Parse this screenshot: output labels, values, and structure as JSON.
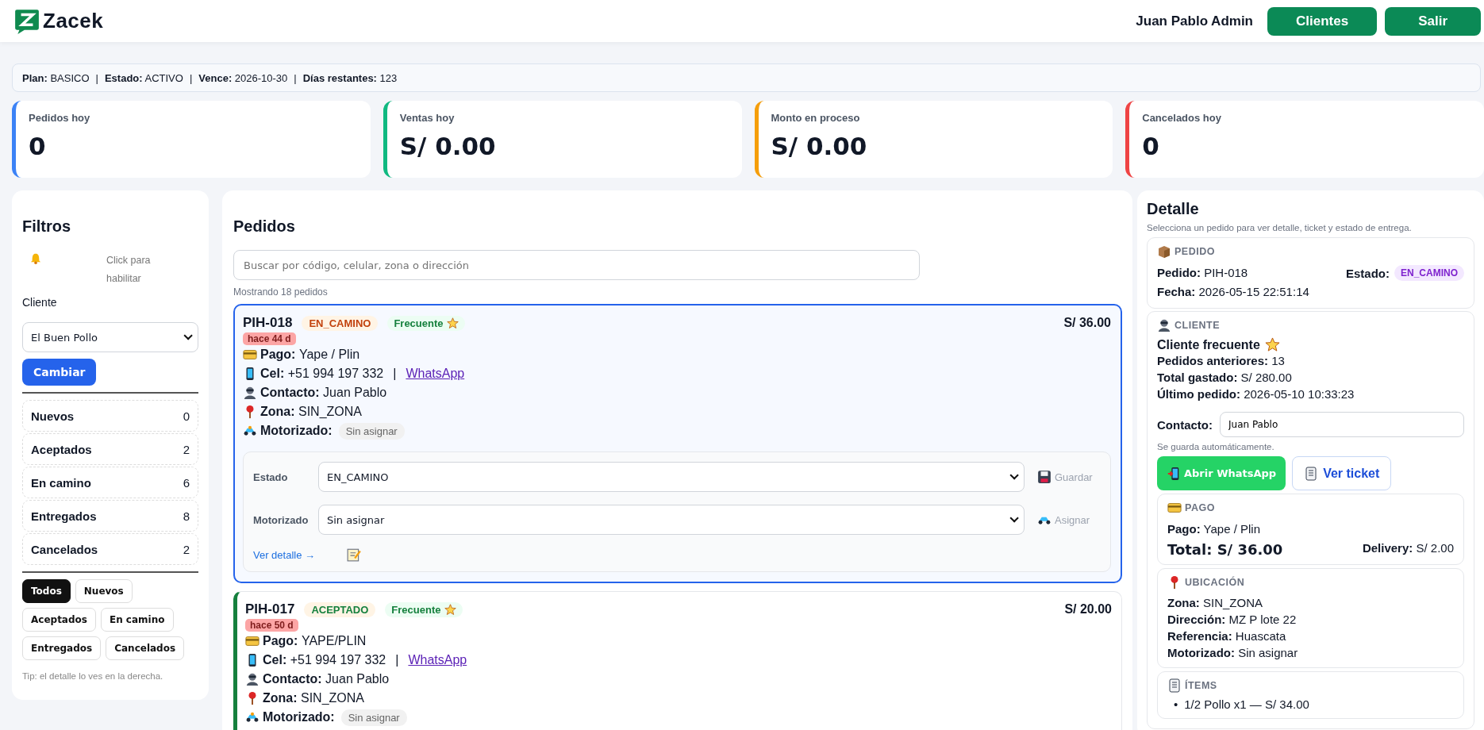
{
  "header": {
    "brand": "Zacek",
    "user": "Juan Pablo Admin",
    "buttons": [
      "Clientes",
      "Salir"
    ]
  },
  "plan_bar": [
    {
      "label": "Plan:",
      "value": "BASICO",
      "separator": "|"
    },
    {
      "label": "Estado:",
      "value": "ACTIVO",
      "separator": "|"
    },
    {
      "label": "Vence:",
      "value": "2026-10-30",
      "separator": "|"
    },
    {
      "label": "Días restantes:",
      "value": "123"
    }
  ],
  "stats": [
    {
      "label": "Pedidos hoy",
      "value": "0",
      "color": "#3b82f6"
    },
    {
      "label": "Ventas hoy",
      "value": "S/ 0.00",
      "color": "#10b981"
    },
    {
      "label": "Monto en proceso",
      "value": "S/ 0.00",
      "color": "#f59e0b"
    },
    {
      "label": "Cancelados hoy",
      "value": "0",
      "color": "#ef4444"
    }
  ],
  "filters": {
    "title": "Filtros",
    "notice": "Click para habilitar",
    "client_label": "Cliente",
    "client_value": "El Buen Pollo",
    "change_button": "Cambiar",
    "counts": [
      {
        "label": "Nuevos",
        "count": "0"
      },
      {
        "label": "Aceptados",
        "count": "2"
      },
      {
        "label": "En camino",
        "count": "6"
      },
      {
        "label": "Entregados",
        "count": "8"
      },
      {
        "label": "Cancelados",
        "count": "2"
      }
    ],
    "chips": [
      {
        "label": "Todos",
        "selected": true
      },
      {
        "label": "Nuevos",
        "selected": false
      },
      {
        "label": "Aceptados",
        "selected": false
      },
      {
        "label": "En camino",
        "selected": false
      },
      {
        "label": "Entregados",
        "selected": false
      },
      {
        "label": "Cancelados",
        "selected": false
      }
    ],
    "tip": "Tip: el detalle lo ves en la derecha."
  },
  "orders": {
    "title": "Pedidos",
    "search_placeholder": "Buscar por código, celular, zona o dirección",
    "summary": "Mostrando 18 pedidos",
    "items": [
      {
        "code": "PIH-018",
        "selected": true,
        "status": {
          "label": "EN_CAMINO",
          "color": "#c2410c"
        },
        "tag": "Frecuente",
        "age": "hace 44 d",
        "amount": "S/ 36.00",
        "fields": [
          {
            "kind": "payment",
            "label": "Pago:",
            "value": "Yape / Plin"
          },
          {
            "kind": "phone",
            "label": "Cel:",
            "value": "+51 994 197 332",
            "separator": "|",
            "link": "WhatsApp"
          },
          {
            "kind": "contact",
            "label": "Contacto:",
            "value": "Juan Pablo"
          },
          {
            "kind": "zone",
            "label": "Zona:",
            "value": "SIN_ZONA"
          },
          {
            "kind": "courier",
            "label": "Motorizado:",
            "value": "Sin asignar"
          }
        ],
        "editor": {
          "rows": [
            {
              "kind": "save",
              "label": "Estado",
              "value": "EN_CAMINO",
              "action": "Guardar"
            },
            {
              "kind": "assign",
              "label": "Motorizado",
              "value": "Sin asignar",
              "action": "Asignar"
            }
          ],
          "link": "Ver detalle →"
        }
      },
      {
        "code": "PIH-017",
        "selected": false,
        "status": {
          "label": "ACEPTADO",
          "color": "#15803d"
        },
        "tag": "Frecuente",
        "age": "hace 50 d",
        "amount": "S/ 20.00",
        "fields": [
          {
            "kind": "payment",
            "label": "Pago:",
            "value": "YAPE/PLIN"
          },
          {
            "kind": "phone",
            "label": "Cel:",
            "value": "+51 994 197 332",
            "separator": "|",
            "link": "WhatsApp"
          },
          {
            "kind": "contact",
            "label": "Contacto:",
            "value": "Juan Pablo"
          },
          {
            "kind": "zone",
            "label": "Zona:",
            "value": "SIN_ZONA"
          },
          {
            "kind": "courier",
            "label": "Motorizado:",
            "value": "Sin asignar"
          }
        ]
      }
    ]
  },
  "detail": {
    "title": "Detalle",
    "subtitle": "Selecciona un pedido para ver detalle, ticket y estado de entrega.",
    "order": {
      "heading": "PEDIDO",
      "code_label": "Pedido:",
      "code": "PIH-018",
      "status_label": "Estado:",
      "status": "EN_CAMINO",
      "date_label": "Fecha:",
      "date": "2026-05-15 22:51:14"
    },
    "client": {
      "heading": "CLIENTE",
      "frequent": "Cliente frecuente",
      "lines": [
        {
          "label": "Pedidos anteriores:",
          "value": "13"
        },
        {
          "label": "Total gastado:",
          "value": "S/ 280.00"
        },
        {
          "label": "Último pedido:",
          "value": "2026-05-10 10:33:23"
        }
      ],
      "contact_label": "Contacto:",
      "contact_value": "Juan Pablo",
      "note": "Se guarda automáticamente.",
      "whatsapp_button": "Abrir WhatsApp",
      "ticket_button": "Ver ticket"
    },
    "payment": {
      "heading": "PAGO",
      "label": "Pago:",
      "value": "Yape / Plin",
      "total": "Total: S/ 36.00",
      "delivery_label": "Delivery:",
      "delivery": "S/ 2.00"
    },
    "location": {
      "heading": "UBICACIÓN",
      "lines": [
        {
          "label": "Zona:",
          "value": "SIN_ZONA"
        },
        {
          "label": "Dirección:",
          "value": "MZ P lote 22"
        },
        {
          "label": "Referencia:",
          "value": "Huascata"
        },
        {
          "label": "Motorizado:",
          "value": "Sin asignar"
        }
      ]
    },
    "items": {
      "heading": "ÍTEMS",
      "list": [
        {
          "bullet": "•",
          "text": "1/2 Pollo x1 — S/ 34.00"
        }
      ]
    }
  }
}
